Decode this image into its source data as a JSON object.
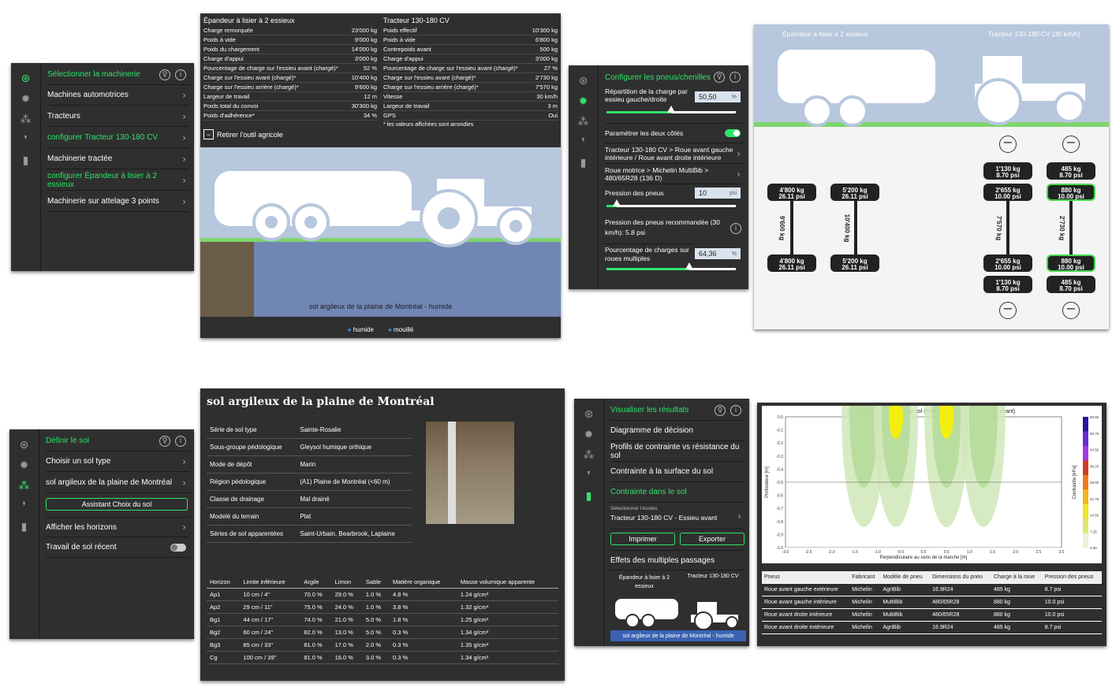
{
  "q1": {
    "menu": [
      {
        "label": "Sélectionner la machinerie",
        "active": true
      },
      {
        "label": "Machines automotrices"
      },
      {
        "label": "Tracteurs"
      },
      {
        "label": "configurer Tracteur 130-180 CV",
        "active": true
      },
      {
        "label": "Machinerie tractée"
      },
      {
        "label": "configurer Épandeur à lisier à 2 essieux",
        "active": true
      },
      {
        "label": "Machinerie sur attelage 3 points"
      }
    ],
    "left_title": "Épandeur à lisier à 2 essieux",
    "right_title": "Tracteur 130-180 CV",
    "left_rows": [
      [
        "Charge remorquée",
        "23'000 kg"
      ],
      [
        "Poids à vide",
        "9'000 kg"
      ],
      [
        "Poids du chargement",
        "14'000 kg"
      ],
      [
        "Charge d'appui",
        "3'000 kg"
      ],
      [
        "Pourcentage de charge sur l'essieu avant (chargé)*",
        "52 %"
      ],
      [
        "Charge sur l'essieu avant (chargé)*",
        "10'400 kg"
      ],
      [
        "Charge sur l'essieu arrière (chargé)*",
        "9'600 kg"
      ],
      [
        "Largeur de travail",
        "12 m"
      ],
      [
        "Poids total du convoi",
        "30'300 kg"
      ],
      [
        "Poids d'adhérence*",
        "34 %"
      ]
    ],
    "right_rows": [
      [
        "Poids effectif",
        "10'300 kg"
      ],
      [
        "Poids à vide",
        "6'800 kg"
      ],
      [
        "Contrepoids avant",
        "500 kg"
      ],
      [
        "Charge d'appui",
        "3'000 kg"
      ],
      [
        "Pourcentage de charge sur l'essieu avant (chargé)*",
        "27 %"
      ],
      [
        "Charge sur l'essieu avant (chargé)*",
        "2'730 kg"
      ],
      [
        "Charge sur l'essieu arrière (chargé)*",
        "7'570 kg"
      ],
      [
        "Vitesse",
        "30 km/h"
      ],
      [
        "Largeur de travail",
        "3 m"
      ],
      [
        "GPS",
        "Oui"
      ]
    ],
    "footnote": "* les valeurs affichées sont arrondies",
    "remove_tool": "Retirer l'outil agricole",
    "soil_caption": "sol argileux de la plaine de Montréal - humide",
    "legend": [
      "humide",
      "mouillé"
    ]
  },
  "q2": {
    "title": "Configurer les pneus/chenilles",
    "load_split_label": "Répartition de la charge par essieu gauche/droite",
    "load_split_value": "50,50",
    "load_split_unit": "%",
    "load_split_level": 0.5,
    "both_sides_label": "Paramétrer les deux côtés",
    "wheel_select": "Tracteur 130-180 CV > Roue avant gauche intérieure / Roue avant droite intérieure",
    "tyre_select": "Roue motrice > Michelin MultiBib > 480/65R28 (136 D)",
    "pressure_label": "Pression des pneus",
    "pressure_value": "10",
    "pressure_unit": "psi",
    "pressure_level": 0.08,
    "recommended": "Pression des pneus recommandée (30 km/h): 5.8 psi",
    "multi_label": "Pourcentage de charges sur roues multiples",
    "multi_value": "64,36",
    "multi_unit": "%",
    "multi_level": 0.64,
    "diagram_left": "Épandeur à lisier à 2 essieux",
    "diagram_right": "Tracteur 130-180 CV (30 km/h)",
    "tyres": {
      "a1t": [
        "4'800 kg",
        "26.11 psi"
      ],
      "a1b": [
        "4'800 kg",
        "26.11 psi"
      ],
      "a1v": "9'600 kg",
      "a2t": [
        "5'200 kg",
        "26.11 psi"
      ],
      "a2b": [
        "5'200 kg",
        "26.11 psi"
      ],
      "a2v": "10'400 kg",
      "a3o1": [
        "1'130 kg",
        "8.70 psi"
      ],
      "a3i1": [
        "2'655 kg",
        "10.00 psi"
      ],
      "a3i2": [
        "2'655 kg",
        "10.00 psi"
      ],
      "a3o2": [
        "1'130 kg",
        "8.70 psi"
      ],
      "a3v": "7'570 kg",
      "a4o1": [
        "485 kg",
        "8.70 psi"
      ],
      "a4i1": [
        "880 kg",
        "10.00 psi"
      ],
      "a4i2": [
        "880 kg",
        "10.00 psi"
      ],
      "a4o2": [
        "485 kg",
        "8.70 psi"
      ],
      "a4v": "2'730 kg"
    }
  },
  "q3": {
    "menu": [
      {
        "label": "Définir le sol",
        "active": true
      },
      {
        "label": "Choisir un sol type"
      },
      {
        "label": "sol argileux de la plaine de Montréal"
      },
      {
        "label": "Assistant Choix du sol"
      },
      {
        "label": "Afficher les horizons"
      },
      {
        "label": "Travail de sol récent"
      }
    ],
    "title": "sol argileux de la plaine de Montréal",
    "props": [
      [
        "Série de sol type",
        "Sainte-Rosalie"
      ],
      [
        "Sous-groupe pédologique",
        "Gleysol humique orthique"
      ],
      [
        "Mode de dépôt",
        "Marin"
      ],
      [
        "Région pédologique",
        "(A1) Plaine de Montréal (<60 m)"
      ],
      [
        "Classe de drainage",
        "Mal drainé"
      ],
      [
        "Modelé du terrain",
        "Plat"
      ],
      [
        "Séries de sol apparentées",
        "Saint-Urbain, Bearbrook, Laplaine"
      ]
    ],
    "hz_headers": [
      "Horizon",
      "Limite inférieure",
      "Argile",
      "Limon",
      "Sable",
      "Matière organique",
      "Masse volumique apparente"
    ],
    "hz_rows": [
      [
        "Ap1",
        "10 cm / 4\"",
        "70.0 %",
        "29.0 %",
        "1.0 %",
        "4.8 %",
        "1.24 g/cm³"
      ],
      [
        "Ap2",
        "29 cm / 11\"",
        "75.0 %",
        "24.0 %",
        "1.0 %",
        "3.8 %",
        "1.32 g/cm³"
      ],
      [
        "Bg1",
        "44 cm / 17\"",
        "74.0 %",
        "21.0 %",
        "5.0 %",
        "1.8 %",
        "1.25 g/cm³"
      ],
      [
        "Bg2",
        "60 cm / 24\"",
        "82.0 %",
        "13.0 %",
        "5.0 %",
        "0.3 %",
        "1.34 g/cm³"
      ],
      [
        "Bg3",
        "85 cm / 33\"",
        "81.0 %",
        "17.0 %",
        "2.0 %",
        "0.3 %",
        "1.35 g/cm³"
      ],
      [
        "Cg",
        "100 cm / 39\"",
        "81.0 %",
        "16.0 %",
        "3.0 %",
        "0.3 %",
        "1.34 g/cm³"
      ]
    ]
  },
  "q4": {
    "menu": [
      {
        "label": "Visualiser les résultats",
        "active": true
      },
      {
        "label": "Diagramme de décision"
      },
      {
        "label": "Profils de contrainte vs résistance du sol"
      },
      {
        "label": "Contrainte à la surface du sol"
      },
      {
        "label": "Contrainte dans le sol",
        "active": true
      }
    ],
    "axle_select_label": "Sélectionner l'essieu",
    "axle_select_value": "Tracteur 130-180 CV - Essieu avant",
    "print": "Imprimer",
    "export": "Exporter",
    "multi_pass": "Effets des multiples passages",
    "mini_left": "Épandeur à lisier à 2 essieux",
    "mini_right": "Tracteur 130-180 CV",
    "mini_soil": "sol argileux de la plaine de Montréal - humide",
    "res_headers": [
      "Pneus",
      "Fabricant",
      "Modèle de pneu",
      "Dimensions du pneu",
      "Charge à la roue",
      "Pression des pneus"
    ],
    "res_rows": [
      [
        "Roue avant gauche extérieure",
        "Michelin",
        "AgriBib",
        "16.9R24",
        "485 kg",
        "8.7 psi"
      ],
      [
        "Roue avant gauche intérieure",
        "Michelin",
        "MultiBib",
        "480/65R28",
        "880 kg",
        "10.0 psi"
      ],
      [
        "Roue avant droite intérieure",
        "Michelin",
        "MultiBib",
        "480/65R28",
        "880 kg",
        "10.0 psi"
      ],
      [
        "Roue avant droite extérieure",
        "Michelin",
        "AgriBib",
        "16.9R24",
        "485 kg",
        "8.7 psi"
      ]
    ]
  },
  "chart_data": {
    "type": "heatmap",
    "title": "Contrainte exercée dans le sol (Tracteur 130-180 CV - Essieu avant)",
    "xlabel": "Perpendiculaire au sens de la marche [m]",
    "ylabel": "Profondeur [m]",
    "colorbar_label": "Contrainte [kPa]",
    "xlim": [
      -3.0,
      3.0
    ],
    "ylim": [
      -1.0,
      0.0
    ],
    "xticks": [
      "-3.0",
      "-2.5",
      "-2.0",
      "-1.5",
      "-1.0",
      "-0.5",
      "0.0",
      "0.5",
      "1.0",
      "1.5",
      "2.0",
      "2.5",
      "3.0"
    ],
    "yticks": [
      "0.0",
      "-0.1",
      "-0.2",
      "-0.3",
      "-0.4",
      "-0.5",
      "-0.6",
      "-0.7",
      "-0.8",
      "-0.9",
      "-1.0"
    ],
    "colorbar_ticks": [
      "58.00",
      "50.75",
      "43.50",
      "36.25",
      "29.00",
      "21.75",
      "14.50",
      "7.25",
      "0.00"
    ],
    "reference_depth": -0.5,
    "wheels_x": [
      -1.3,
      -0.6,
      0.5,
      1.3
    ]
  }
}
